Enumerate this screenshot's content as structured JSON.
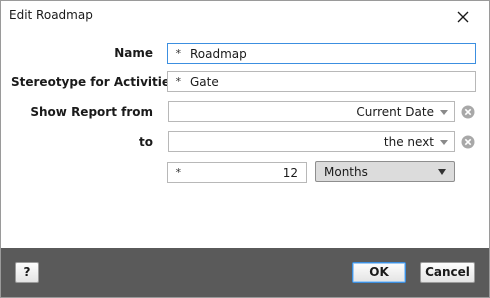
{
  "window": {
    "title": "Edit Roadmap"
  },
  "form": {
    "name": {
      "label": "Name",
      "value": "Roadmap",
      "required_marker": "*"
    },
    "stereotype": {
      "label": "Stereotype for Activities",
      "value": "Gate",
      "required_marker": "*"
    },
    "show_report_from": {
      "label": "Show Report from",
      "value": "Current Date"
    },
    "to": {
      "label": "to",
      "value": "the next"
    },
    "amount": {
      "value": "12",
      "required_marker": "*"
    },
    "unit": {
      "value": "Months"
    }
  },
  "footer": {
    "help_label": "?",
    "ok_label": "OK",
    "cancel_label": "Cancel"
  },
  "colors": {
    "focus_border": "#3c8fe0",
    "footer_bg": "#5a5a5a"
  }
}
